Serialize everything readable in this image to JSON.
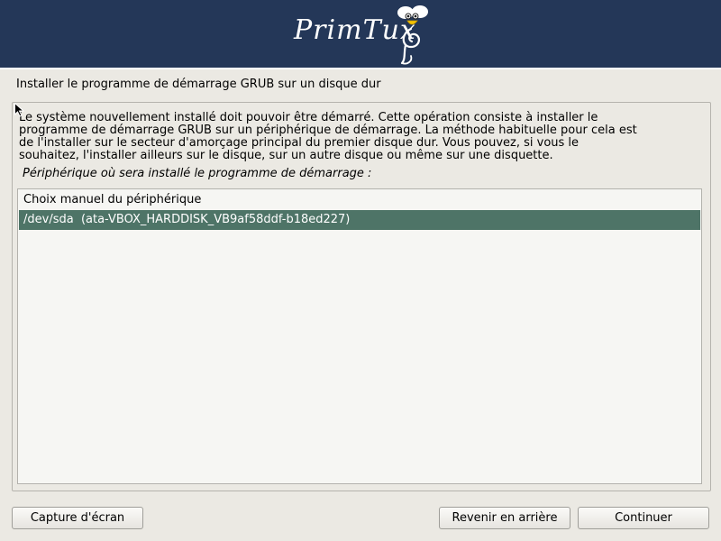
{
  "banner": {
    "logo_text": "PrimTux",
    "background": "#243758"
  },
  "page_title": "Installer le programme de démarrage GRUB sur un disque dur",
  "description": {
    "line1": "Le système nouvellement installé doit pouvoir être démarré. Cette opération consiste à installer le",
    "line2": "programme de démarrage GRUB sur un périphérique de démarrage. La méthode habituelle pour cela est",
    "line3": "de l'installer sur le secteur d'amorçage principal du premier disque dur. Vous pouvez, si vous le",
    "line4": "souhaitez, l'installer ailleurs sur le disque, sur un autre disque ou même sur une disquette."
  },
  "prompt": "Périphérique où sera installé le programme de démarrage :",
  "device_list": {
    "items": [
      {
        "label": "Choix manuel du périphérique",
        "selected": false
      },
      {
        "label": "/dev/sda  (ata-VBOX_HARDDISK_VB9af58ddf-b18ed227)",
        "selected": true
      }
    ],
    "selection_color": "#4e7467"
  },
  "buttons": {
    "screenshot": "Capture d'écran",
    "back": "Revenir en arrière",
    "continue": "Continuer"
  }
}
